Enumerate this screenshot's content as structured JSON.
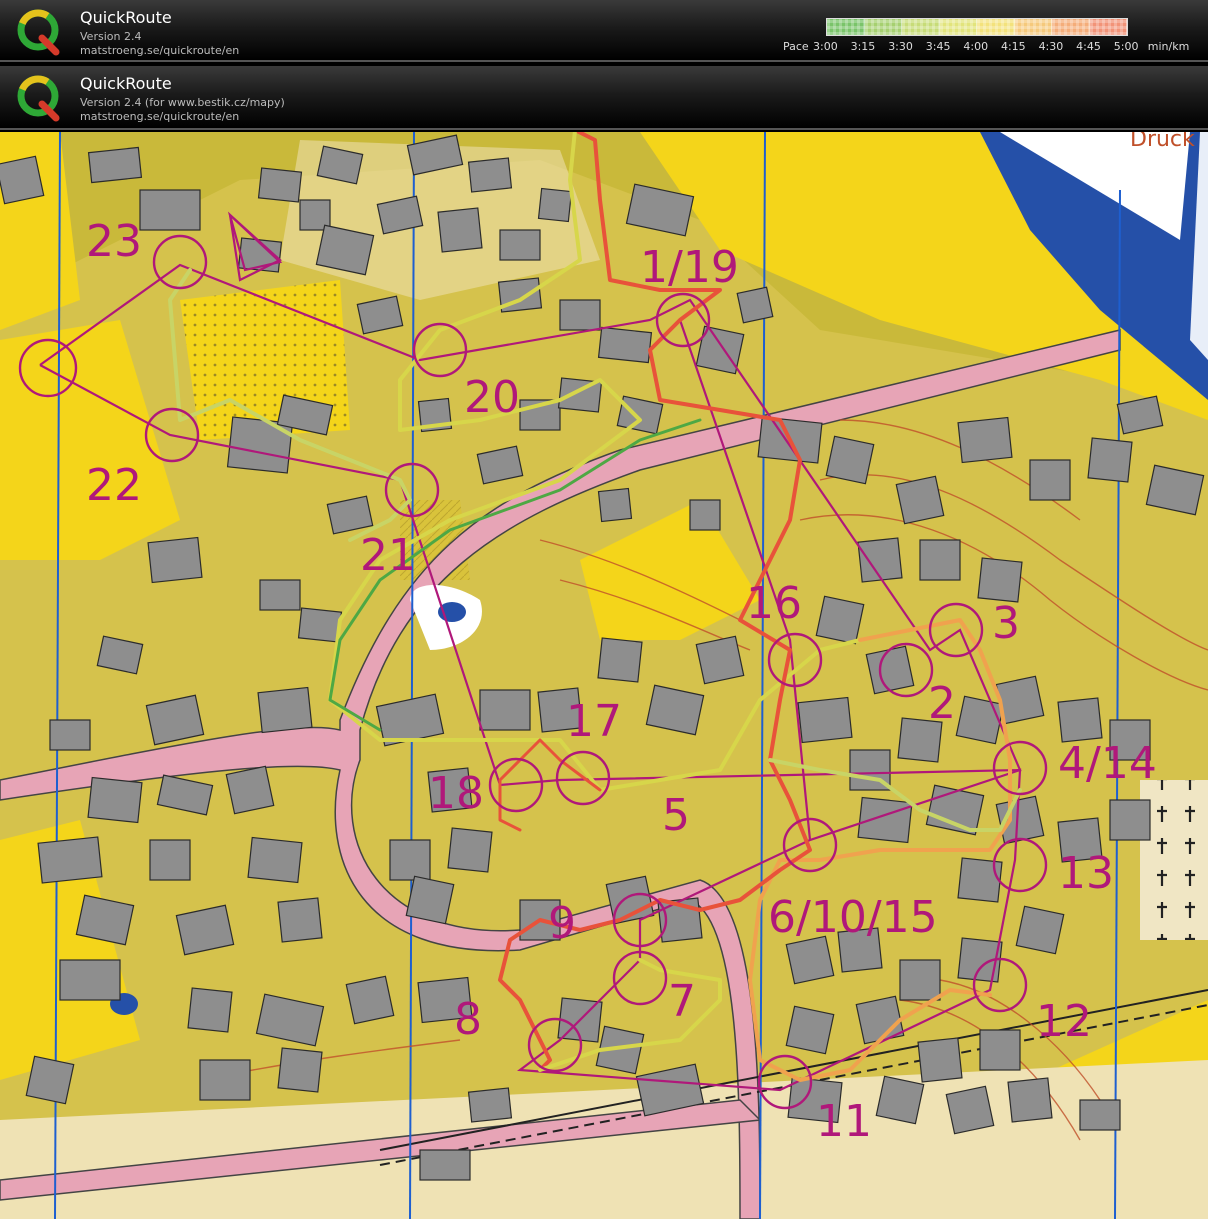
{
  "app": {
    "name": "QuickRoute",
    "version_line_1": "Version 2.4",
    "url_line_1": "matstroeng.se/quickroute/en",
    "version_line_2": "Version 2.4  (for www.bestik.cz/mapy)",
    "url_line_2": "matstroeng.se/quickroute/en"
  },
  "pace_scale": {
    "prefix": "Pace",
    "ticks": [
      "3:00",
      "3:15",
      "3:30",
      "3:45",
      "4:00",
      "4:15",
      "4:30",
      "4:45",
      "5:00"
    ],
    "unit": "min/km",
    "colors": [
      "#7ac46a",
      "#a6d070",
      "#c7dc78",
      "#e2e47c",
      "#f3e27c",
      "#f5c97c",
      "#f4ad7a",
      "#f29378"
    ]
  },
  "map": {
    "corner_text": "Druck",
    "controls": [
      {
        "label": "1/19"
      },
      {
        "label": "2"
      },
      {
        "label": "3"
      },
      {
        "label": "4/14"
      },
      {
        "label": "5"
      },
      {
        "label": "6/10/15"
      },
      {
        "label": "7"
      },
      {
        "label": "8"
      },
      {
        "label": "9"
      },
      {
        "label": "11"
      },
      {
        "label": "12"
      },
      {
        "label": "13"
      },
      {
        "label": "16"
      },
      {
        "label": "17"
      },
      {
        "label": "18"
      },
      {
        "label": "20"
      },
      {
        "label": "21"
      },
      {
        "label": "22"
      },
      {
        "label": "23"
      }
    ],
    "colors": {
      "open": "#f4d51a",
      "rough": "#c9b93a",
      "paved": "#efe2b4",
      "building": "#8e8e8e",
      "road": "#e7a4b6",
      "water": "#2550a8",
      "course": "#b0187a",
      "contour": "#c0502a"
    }
  }
}
